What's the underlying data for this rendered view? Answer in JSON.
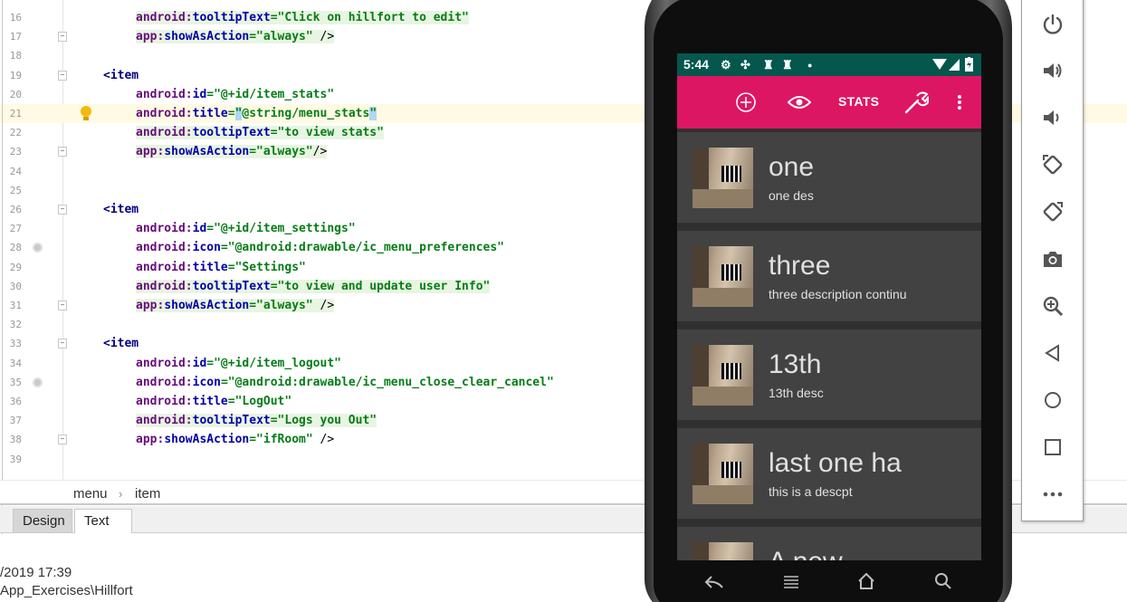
{
  "editor": {
    "lines": [
      {
        "n": "16",
        "gutter": "",
        "segments": [
          {
            "t": "android:",
            "c": "ns"
          },
          {
            "t": "tooltipText",
            "c": "attr2"
          },
          {
            "t": "=\"Click on hillfort to edit\"",
            "c": "val"
          }
        ],
        "indent": 150,
        "hl": true
      },
      {
        "n": "17",
        "gutter": "fold",
        "segments": [
          {
            "t": "app:",
            "c": "ns"
          },
          {
            "t": "showAsAction",
            "c": "attr2"
          },
          {
            "t": "=\"always\"",
            "c": "val"
          },
          {
            "t": " />",
            "c": "punct"
          }
        ],
        "indent": 150,
        "hl": true
      },
      {
        "n": "18",
        "gutter": "",
        "segments": [],
        "indent": 150
      },
      {
        "n": "19",
        "gutter": "fold",
        "segments": [
          {
            "t": "<item",
            "c": "tag"
          }
        ],
        "indent": 114
      },
      {
        "n": "20",
        "gutter": "",
        "segments": [
          {
            "t": "android:",
            "c": "ns"
          },
          {
            "t": "id",
            "c": "attr2"
          },
          {
            "t": "=\"@+id/item_stats\"",
            "c": "val"
          }
        ],
        "indent": 150
      },
      {
        "n": "21",
        "gutter": "bulb",
        "segments": [
          {
            "t": "android:",
            "c": "ns"
          },
          {
            "t": "title",
            "c": "attr2"
          },
          {
            "t": "=",
            "c": "val"
          },
          {
            "t": "\"",
            "c": "selq"
          },
          {
            "t": "@string/menu_stats",
            "c": "val"
          },
          {
            "t": "\"",
            "c": "selq"
          }
        ],
        "indent": 150,
        "current": true
      },
      {
        "n": "22",
        "gutter": "",
        "segments": [
          {
            "t": "android:",
            "c": "ns"
          },
          {
            "t": "tooltipText",
            "c": "attr2"
          },
          {
            "t": "=\"to view stats\"",
            "c": "val"
          }
        ],
        "indent": 150,
        "hl": true
      },
      {
        "n": "23",
        "gutter": "fold",
        "segments": [
          {
            "t": "app:",
            "c": "ns"
          },
          {
            "t": "showAsAction",
            "c": "attr2"
          },
          {
            "t": "=\"always\"",
            "c": "val"
          },
          {
            "t": "/>",
            "c": "punct"
          }
        ],
        "indent": 150,
        "hl": true
      },
      {
        "n": "24",
        "gutter": "",
        "segments": [],
        "indent": 150
      },
      {
        "n": "25",
        "gutter": "",
        "segments": [],
        "indent": 150
      },
      {
        "n": "26",
        "gutter": "fold",
        "segments": [
          {
            "t": "<item",
            "c": "tag"
          }
        ],
        "indent": 114
      },
      {
        "n": "27",
        "gutter": "",
        "segments": [
          {
            "t": "android:",
            "c": "ns"
          },
          {
            "t": "id",
            "c": "attr2"
          },
          {
            "t": "=\"@+id/item_settings\"",
            "c": "val"
          }
        ],
        "indent": 150
      },
      {
        "n": "28",
        "gutter": "gicon",
        "segments": [
          {
            "t": "android:",
            "c": "ns"
          },
          {
            "t": "icon",
            "c": "attr2"
          },
          {
            "t": "=\"@android:drawable/ic_menu_preferences\"",
            "c": "val"
          }
        ],
        "indent": 150
      },
      {
        "n": "29",
        "gutter": "",
        "segments": [
          {
            "t": "android:",
            "c": "ns"
          },
          {
            "t": "title",
            "c": "attr2"
          },
          {
            "t": "=\"Settings\"",
            "c": "val"
          }
        ],
        "indent": 150
      },
      {
        "n": "30",
        "gutter": "",
        "segments": [
          {
            "t": "android:",
            "c": "ns"
          },
          {
            "t": "tooltipText",
            "c": "attr2"
          },
          {
            "t": "=\"to view and update user Info\"",
            "c": "val"
          }
        ],
        "indent": 150,
        "hl": true
      },
      {
        "n": "31",
        "gutter": "fold",
        "segments": [
          {
            "t": "app:",
            "c": "ns"
          },
          {
            "t": "showAsAction",
            "c": "attr2"
          },
          {
            "t": "=\"always\"",
            "c": "val"
          },
          {
            "t": " />",
            "c": "punct"
          }
        ],
        "indent": 150,
        "hl": true
      },
      {
        "n": "32",
        "gutter": "",
        "segments": [],
        "indent": 150
      },
      {
        "n": "33",
        "gutter": "fold",
        "segments": [
          {
            "t": "<item",
            "c": "tag"
          }
        ],
        "indent": 114
      },
      {
        "n": "34",
        "gutter": "",
        "segments": [
          {
            "t": "android:",
            "c": "ns"
          },
          {
            "t": "id",
            "c": "attr2"
          },
          {
            "t": "=\"@+id/item_logout\"",
            "c": "val"
          }
        ],
        "indent": 150
      },
      {
        "n": "35",
        "gutter": "gicon",
        "segments": [
          {
            "t": "android:",
            "c": "ns"
          },
          {
            "t": "icon",
            "c": "attr2"
          },
          {
            "t": "=\"@android:drawable/ic_menu_close_clear_cancel\"",
            "c": "val"
          }
        ],
        "indent": 150
      },
      {
        "n": "36",
        "gutter": "",
        "segments": [
          {
            "t": "android:",
            "c": "ns"
          },
          {
            "t": "title",
            "c": "attr2"
          },
          {
            "t": "=\"LogOut\"",
            "c": "val"
          }
        ],
        "indent": 150
      },
      {
        "n": "37",
        "gutter": "",
        "segments": [
          {
            "t": "android:",
            "c": "ns"
          },
          {
            "t": "tooltipText",
            "c": "attr2"
          },
          {
            "t": "=\"Logs you Out\"",
            "c": "val"
          }
        ],
        "indent": 150,
        "hl": true
      },
      {
        "n": "38",
        "gutter": "fold",
        "segments": [
          {
            "t": "app:",
            "c": "ns"
          },
          {
            "t": "showAsAction",
            "c": "attr2"
          },
          {
            "t": "=\"ifRoom\"",
            "c": "val"
          },
          {
            "t": " />",
            "c": "punct"
          }
        ],
        "indent": 150
      },
      {
        "n": "39",
        "gutter": "",
        "segments": [],
        "indent": 150
      }
    ]
  },
  "breadcrumb": {
    "first": "menu",
    "sep": "›",
    "second": "item"
  },
  "tabs": {
    "design": "Design",
    "text": "Text"
  },
  "status": {
    "line1": "/2019 17:39",
    "line2": "App_Exercises\\Hillfort"
  },
  "phone": {
    "time": "5:44",
    "toolbar": {
      "stats_label": "STATS",
      "accent": "#dd1663",
      "statusbar_color": "#05574e"
    },
    "cards": [
      {
        "title": "one",
        "desc": "one des"
      },
      {
        "title": "three",
        "desc": "three description continu"
      },
      {
        "title": "13th",
        "desc": "13th desc"
      },
      {
        "title": "last one ha",
        "desc": "this is a descpt"
      },
      {
        "title": "A new",
        "desc": ""
      }
    ],
    "nav_icons": [
      "back-icon",
      "menu-icon",
      "home-icon",
      "search-icon"
    ]
  },
  "emulator": {
    "buttons": [
      "power-icon",
      "volume-up-icon",
      "volume-down-icon",
      "rotate-left-icon",
      "rotate-right-icon",
      "camera-icon",
      "zoom-in-icon",
      "back-triangle-icon",
      "home-circle-icon",
      "overview-square-icon",
      "more-icon"
    ]
  }
}
